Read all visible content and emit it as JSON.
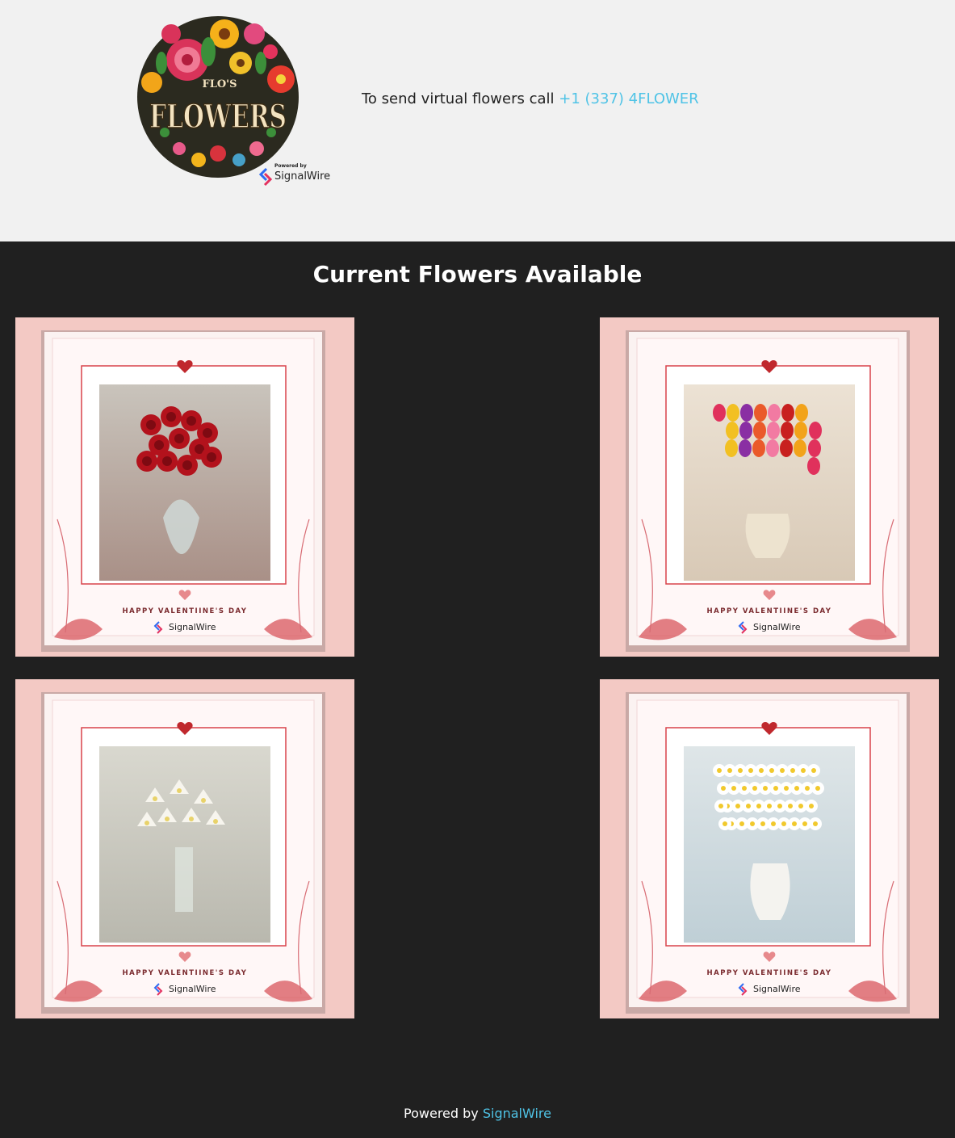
{
  "header": {
    "logo": {
      "arc_text": "FLO'S",
      "main_text": "FLOWERS",
      "powered_by": "Powered by",
      "brand": "SignalWire"
    },
    "call_prefix": "To send virtual flowers call",
    "phone": "+1 (337) 4FLOWER"
  },
  "main": {
    "title": "Current Flowers Available",
    "cards": [
      {
        "flower": "red-roses",
        "caption": "HAPPY VALENTIINE'S DAY",
        "brand": "SignalWire"
      },
      {
        "flower": "tulips",
        "caption": "HAPPY VALENTIINE'S DAY",
        "brand": "SignalWire"
      },
      {
        "flower": "lilies",
        "caption": "HAPPY VALENTIINE'S DAY",
        "brand": "SignalWire"
      },
      {
        "flower": "daisies",
        "caption": "HAPPY VALENTIINE'S DAY",
        "brand": "SignalWire"
      }
    ]
  },
  "footer": {
    "prefix": "Powered by",
    "link": "SignalWire"
  },
  "colors": {
    "header_bg": "#f1f1f1",
    "main_bg": "#202020",
    "link": "#4fc3e6",
    "card_bg": "#f3c9c4",
    "heart": "#c0282d"
  }
}
